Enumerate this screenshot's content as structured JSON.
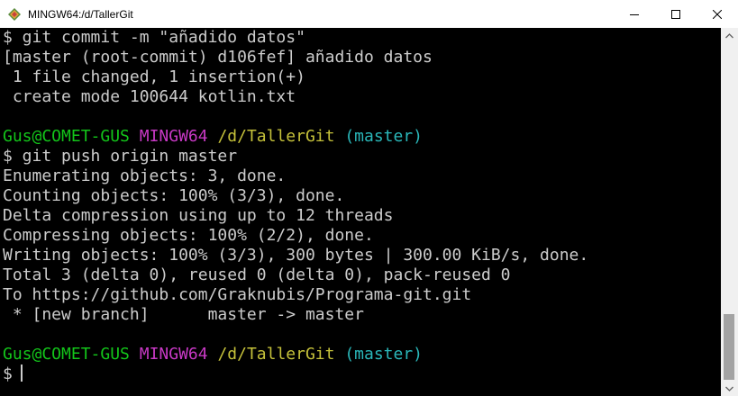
{
  "window": {
    "title": "MINGW64:/d/TallerGit",
    "icon": "mingw-diamond-icon"
  },
  "controls": {
    "minimize": "minimize-icon",
    "maximize": "maximize-icon",
    "close": "close-icon"
  },
  "terminal": {
    "lines": [
      "$ git commit -m \"añadido datos\"",
      "[master (root-commit) d106fef] añadido datos",
      " 1 file changed, 1 insertion(+)",
      " create mode 100644 kotlin.txt",
      "",
      "",
      "$ git push origin master",
      "Enumerating objects: 3, done.",
      "Counting objects: 100% (3/3), done.",
      "Delta compression using up to 12 threads",
      "Compressing objects: 100% (2/2), done.",
      "Writing objects: 100% (3/3), 300 bytes | 300.00 KiB/s, done.",
      "Total 3 (delta 0), reused 0 (delta 0), pack-reused 0",
      "To https://github.com/Graknubis/Programa-git.git",
      " * [new branch]      master -> master",
      "",
      "",
      "$"
    ],
    "prompt1": {
      "user_host": "Gus@COMET-GUS",
      "system": "MINGW64",
      "path": "/d/TallerGit",
      "branch": "(master)"
    },
    "prompt2": {
      "user_host": "Gus@COMET-GUS",
      "system": "MINGW64",
      "path": "/d/TallerGit",
      "branch": "(master)"
    }
  },
  "colors": {
    "background": "#000000",
    "text": "#cccccc",
    "user_host": "#13c51a",
    "system": "#c839c5",
    "path": "#c5c13a",
    "branch": "#2ab7b9"
  }
}
